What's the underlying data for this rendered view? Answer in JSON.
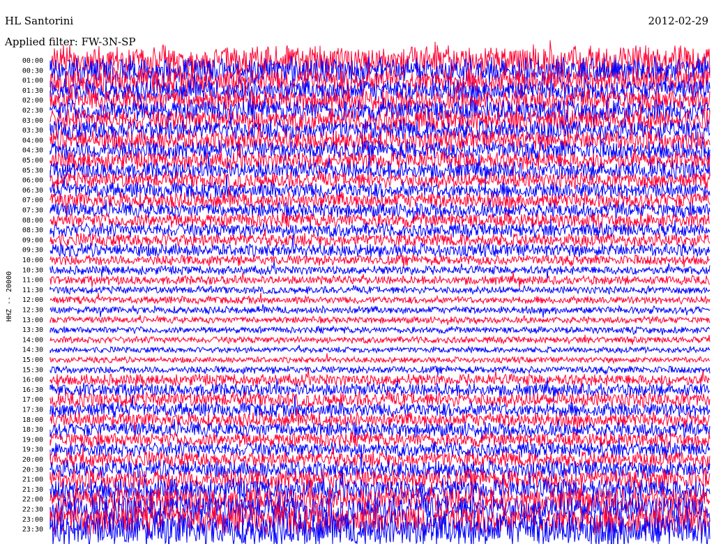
{
  "header": {
    "station": "HL Santorini",
    "filter": "Applied filter: FW-3N-SP",
    "date": "2012-02-29"
  },
  "chart_data": {
    "type": "line",
    "title": "HL Santorini",
    "ylabel": "HHZ -- 20000",
    "rows": [
      "00:00",
      "00:30",
      "01:00",
      "01:30",
      "02:00",
      "02:30",
      "03:00",
      "03:30",
      "04:00",
      "04:30",
      "05:00",
      "05:30",
      "06:00",
      "06:30",
      "07:00",
      "07:30",
      "08:00",
      "08:30",
      "09:00",
      "09:30",
      "10:00",
      "10:30",
      "11:00",
      "11:30",
      "12:00",
      "12:30",
      "13:00",
      "13:30",
      "14:00",
      "14:30",
      "15:00",
      "15:30",
      "16:00",
      "16:30",
      "17:00",
      "17:30",
      "18:00",
      "18:30",
      "19:00",
      "19:30",
      "20:00",
      "20:30",
      "21:00",
      "21:30",
      "22:00",
      "22:30",
      "23:00",
      "23:30"
    ],
    "row_amplitude": [
      4.0,
      3.5,
      3.5,
      3.0,
      3.0,
      3.0,
      3.0,
      2.8,
      2.8,
      2.6,
      2.5,
      2.4,
      2.2,
      2.2,
      2.2,
      2.0,
      2.0,
      1.9,
      1.8,
      1.8,
      1.4,
      1.2,
      1.2,
      1.0,
      1.0,
      1.0,
      0.9,
      0.9,
      0.9,
      0.8,
      0.8,
      1.0,
      1.6,
      1.8,
      2.0,
      2.0,
      2.0,
      2.0,
      2.0,
      2.0,
      2.2,
      2.4,
      2.8,
      3.0,
      3.4,
      3.8,
      4.2,
      4.6
    ],
    "series_colors": [
      "#ff0033",
      "#0000ff"
    ],
    "grid": false
  }
}
